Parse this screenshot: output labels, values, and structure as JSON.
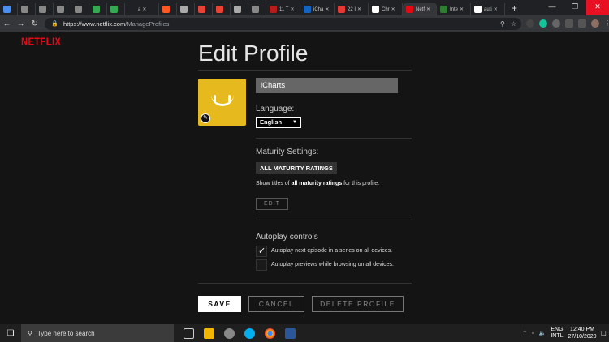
{
  "browser": {
    "tabs": [
      {
        "title": "",
        "color": "#4b8ef1"
      },
      {
        "title": "",
        "color": "#888888"
      },
      {
        "title": "",
        "color": "#888888"
      },
      {
        "title": "",
        "color": "#888888"
      },
      {
        "title": "",
        "color": "#888888"
      },
      {
        "title": "",
        "color": "#34a853"
      },
      {
        "title": "",
        "color": "#34a853"
      },
      {
        "title": "a",
        "color": "#202124"
      },
      {
        "title": "",
        "color": "#ff5722"
      },
      {
        "title": "",
        "color": "#aaaaaa"
      },
      {
        "title": "",
        "color": "#ea4335"
      },
      {
        "title": "",
        "color": "#ea4335"
      },
      {
        "title": "",
        "color": "#aaaaaa"
      },
      {
        "title": "",
        "color": "#888888"
      },
      {
        "title": "11 T",
        "color": "#b71c1c"
      },
      {
        "title": "iCha",
        "color": "#1565c0"
      },
      {
        "title": "22 I",
        "color": "#e53935"
      },
      {
        "title": "Chr",
        "color": "#ffffff"
      },
      {
        "title": "Netf",
        "color": "#e50914",
        "active": true
      },
      {
        "title": "Inte",
        "color": "#2e7d32"
      },
      {
        "title": "auti",
        "color": "#ffffff"
      }
    ],
    "url_domain": "https://www.netflix.com",
    "url_path": "/ManageProfiles"
  },
  "brand": "NETFLIX",
  "page": {
    "title": "Edit Profile",
    "profile_name": "iCharts",
    "language_label": "Language:",
    "language_value": "English",
    "maturity_label": "Maturity Settings:",
    "maturity_badge": "ALL MATURITY RATINGS",
    "maturity_desc_pre": "Show titles of ",
    "maturity_desc_bold": "all maturity ratings",
    "maturity_desc_post": " for this profile.",
    "edit_label": "EDIT",
    "autoplay_label": "Autoplay controls",
    "autoplay_next": "Autoplay next episode in a series on all devices.",
    "autoplay_next_checked": true,
    "autoplay_previews": "Autoplay previews while browsing on all devices.",
    "autoplay_previews_checked": false,
    "save_label": "SAVE",
    "cancel_label": "CANCEL",
    "delete_label": "DELETE PROFILE"
  },
  "taskbar": {
    "search_placeholder": "Type here to search",
    "lang_top": "ENG",
    "lang_bottom": "INTL",
    "time": "12:40 PM",
    "date": "27/10/2020"
  }
}
